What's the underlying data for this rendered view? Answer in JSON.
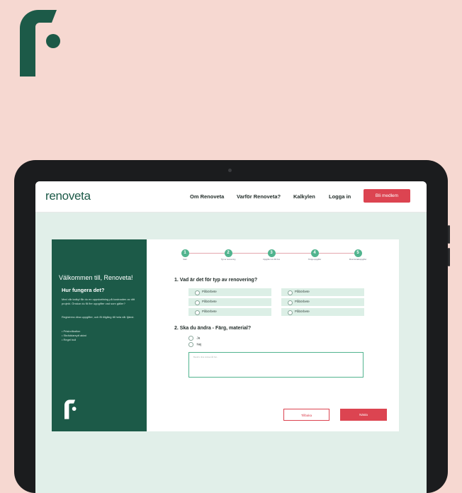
{
  "colors": {
    "background": "#f6d8d1",
    "brand_green": "#1c5a48",
    "accent_red": "#dc4451",
    "step_green": "#52b48f",
    "screen_bg": "#e1efe9"
  },
  "site": {
    "brand": "renoveta",
    "nav": [
      "Om Renoveta",
      "Varför Renoveta?",
      "Kalkylen",
      "Logga in"
    ],
    "cta": "Bli medlem"
  },
  "panel": {
    "welcome": "Välkommen till, Renoveta!",
    "how_title": "Hur fungera det?",
    "paragraph1": "Med vår kalkyl får du en uppskattning på kostnaden av ditt projekt. Önskar du få fler uppgifter vad som gäller?",
    "paragraph2": "Registrera dina uppgifter, och få tillgång till hela vår tjänst.",
    "bullets": [
      "Prisindikation",
      "Skräddarsytt aktat",
      "Regel bull"
    ]
  },
  "stepper": {
    "steps": [
      {
        "number": "1",
        "label": "Start"
      },
      {
        "number": "2",
        "label": "Typ av renovering"
      },
      {
        "number": "3",
        "label": "Uppgifter om ditt hus"
      },
      {
        "number": "4",
        "label": "Övriga uppgifter"
      },
      {
        "number": "5",
        "label": "Dina kontaktuppgifter"
      }
    ]
  },
  "question1": {
    "title": "1. Vad är det för typ av renovering?",
    "options": [
      "Påbörbete",
      "Påbörbete",
      "Påbörbete",
      "Påbörbete",
      "Påbörbete",
      "Påbörbete"
    ]
  },
  "question2": {
    "title": "2. Ska du ändra - Färg, material?",
    "yes": "Ja",
    "no": "Nej",
    "placeholder": "Beskriv dina önskemål här..."
  },
  "buttons": {
    "back": "Tillbaka",
    "next": "Nästa"
  }
}
